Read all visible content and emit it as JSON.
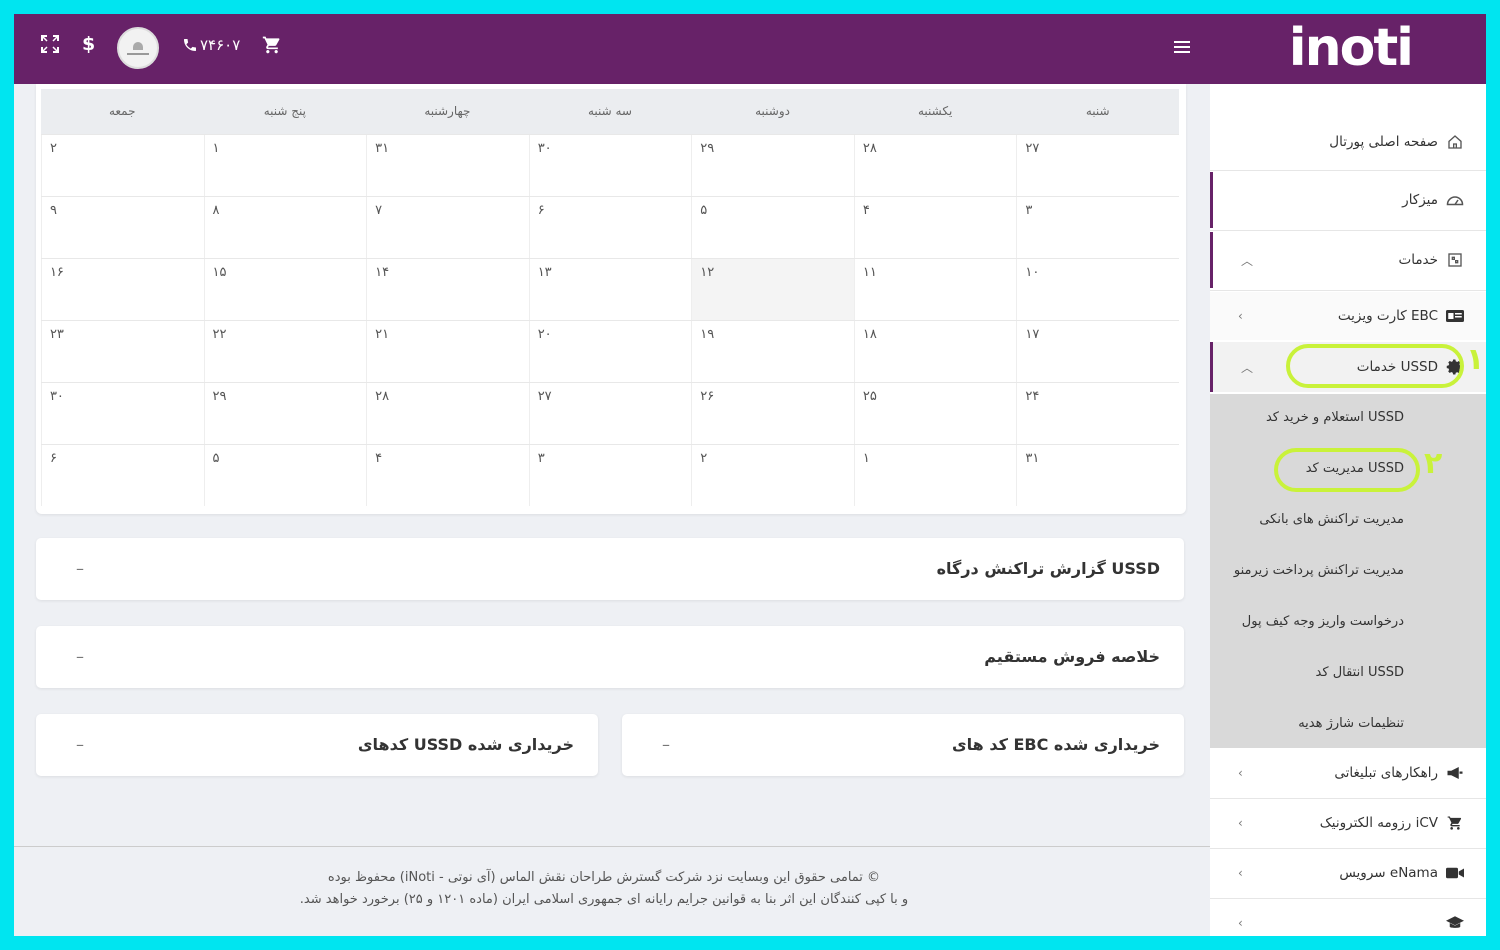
{
  "header": {
    "logo": "inoti",
    "phone": "۷۴۶۰۷",
    "dollar": "$"
  },
  "sidebar": {
    "home": "صفحه اصلی پورتال",
    "dashboard": "میزکار",
    "services": "خدمات",
    "ebc_card": "کارت ویزیت EBC",
    "ussd_services": "خدمات USSD",
    "submenu": [
      "استعلام و خرید کد USSD",
      "مدیریت کد USSD",
      "مدیریت تراکنش های بانکی",
      "مدیریت تراکنش پرداخت زیرمنو",
      "درخواست واریز وجه کیف پول",
      "انتقال کد USSD",
      "تنظیمات شارژ هدیه"
    ],
    "ad_solutions": "راهکارهای تبلیغاتی",
    "icv": "رزومه الکترونیک iCV",
    "enama": "سرویس eNama",
    "highlight_1": "۱",
    "highlight_2": "۲"
  },
  "calendar": {
    "days": [
      "شنبه",
      "یکشنبه",
      "دوشنبه",
      "سه شنبه",
      "چهارشنبه",
      "پنج شنبه",
      "جمعه"
    ],
    "rows": [
      [
        "۲۷",
        "۲۸",
        "۲۹",
        "۳۰",
        "۳۱",
        "۱",
        "۲"
      ],
      [
        "۳",
        "۴",
        "۵",
        "۶",
        "۷",
        "۸",
        "۹"
      ],
      [
        "۱۰",
        "۱۱",
        "۱۲",
        "۱۳",
        "۱۴",
        "۱۵",
        "۱۶"
      ],
      [
        "۱۷",
        "۱۸",
        "۱۹",
        "۲۰",
        "۲۱",
        "۲۲",
        "۲۳"
      ],
      [
        "۲۴",
        "۲۵",
        "۲۶",
        "۲۷",
        "۲۸",
        "۲۹",
        "۳۰"
      ],
      [
        "۳۱",
        "۱",
        "۲",
        "۳",
        "۴",
        "۵",
        "۶"
      ]
    ]
  },
  "cards": {
    "ussd_report": "گزارش تراکنش درگاه USSD",
    "direct_sales": "خلاصه فروش مستقیم",
    "ebc_purchased": "کد های EBC خریداری شده",
    "ussd_purchased": "کدهای USSD خریداری شده",
    "collapse": "–"
  },
  "footer": {
    "line1": "© تمامی حقوق این وبسایت نزد شرکت گسترش طراحان نقش الماس (آی نوتی - iNoti) محفوظ بوده",
    "line2": "و با کپی کنندگان این اثر بنا به قوانین جرایم رایانه ای جمهوری اسلامی ایران (ماده ۱۲۰۱ و ۲۵) برخورد خواهد شد."
  }
}
